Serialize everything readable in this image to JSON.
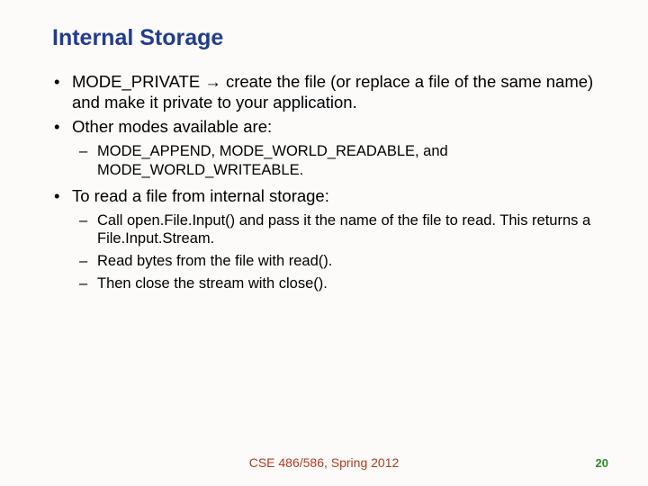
{
  "title": "Internal Storage",
  "bullets": {
    "b1": "MODE_PRIVATE → create the file (or replace a file of the same name) and make it private to your application.",
    "b2": "Other modes available are:",
    "b2_sub1": "MODE_APPEND, MODE_WORLD_READABLE, and MODE_WORLD_WRITEABLE.",
    "b3": "To read a file from internal storage:",
    "b3_sub1": "Call open.File.Input() and pass it the name of the file to read. This returns a File.Input.Stream.",
    "b3_sub2": "Read bytes from the file with read().",
    "b3_sub3": "Then close the stream with close()."
  },
  "footer": {
    "center": "CSE 486/586, Spring 2012",
    "pagenum": "20"
  }
}
